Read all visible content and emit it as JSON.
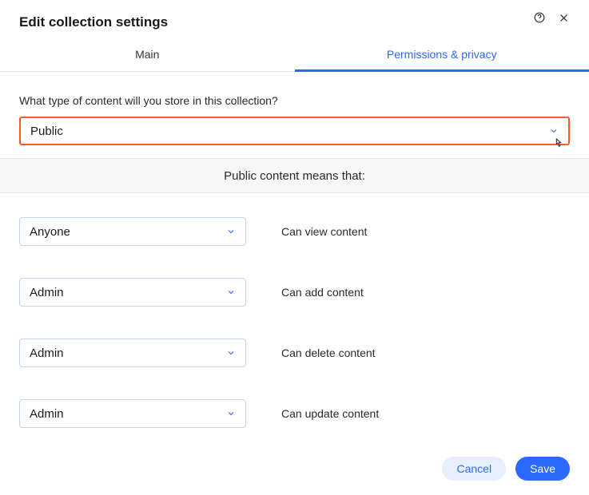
{
  "title": "Edit collection settings",
  "tabs": {
    "main": "Main",
    "permissions": "Permissions & privacy"
  },
  "question": "What type of content will you store in this collection?",
  "content_type_value": "Public",
  "explain": "Public content means that:",
  "rows": [
    {
      "role": "Anyone",
      "action": "Can view content"
    },
    {
      "role": "Admin",
      "action": "Can add content"
    },
    {
      "role": "Admin",
      "action": "Can delete content"
    },
    {
      "role": "Admin",
      "action": "Can update content"
    }
  ],
  "buttons": {
    "cancel": "Cancel",
    "save": "Save"
  }
}
